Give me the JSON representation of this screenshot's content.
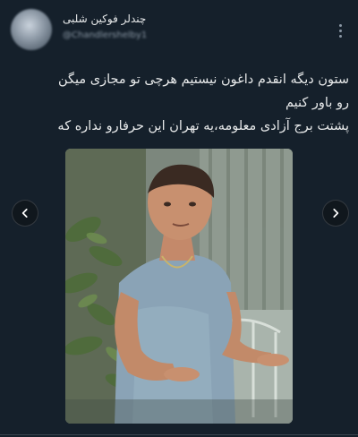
{
  "tweet": {
    "author": {
      "display_name": "چندلر فوکین شلبی",
      "handle": "@Chandlershelby1"
    },
    "text_lines": [
      "ستون دیگه انقدم داغون نیستیم هرچی تو مجازی میگن",
      "رو باور کنیم",
      "پشتت برج آزادی معلومه،یه تهران این حرفارو نداره که"
    ]
  },
  "icons": {
    "more": "more-vertical-icon",
    "prev": "chevron-left-icon",
    "next": "chevron-right-icon"
  },
  "colors": {
    "background": "#15202b",
    "text": "#e7e9ea",
    "secondary_text": "#8b98a5"
  }
}
